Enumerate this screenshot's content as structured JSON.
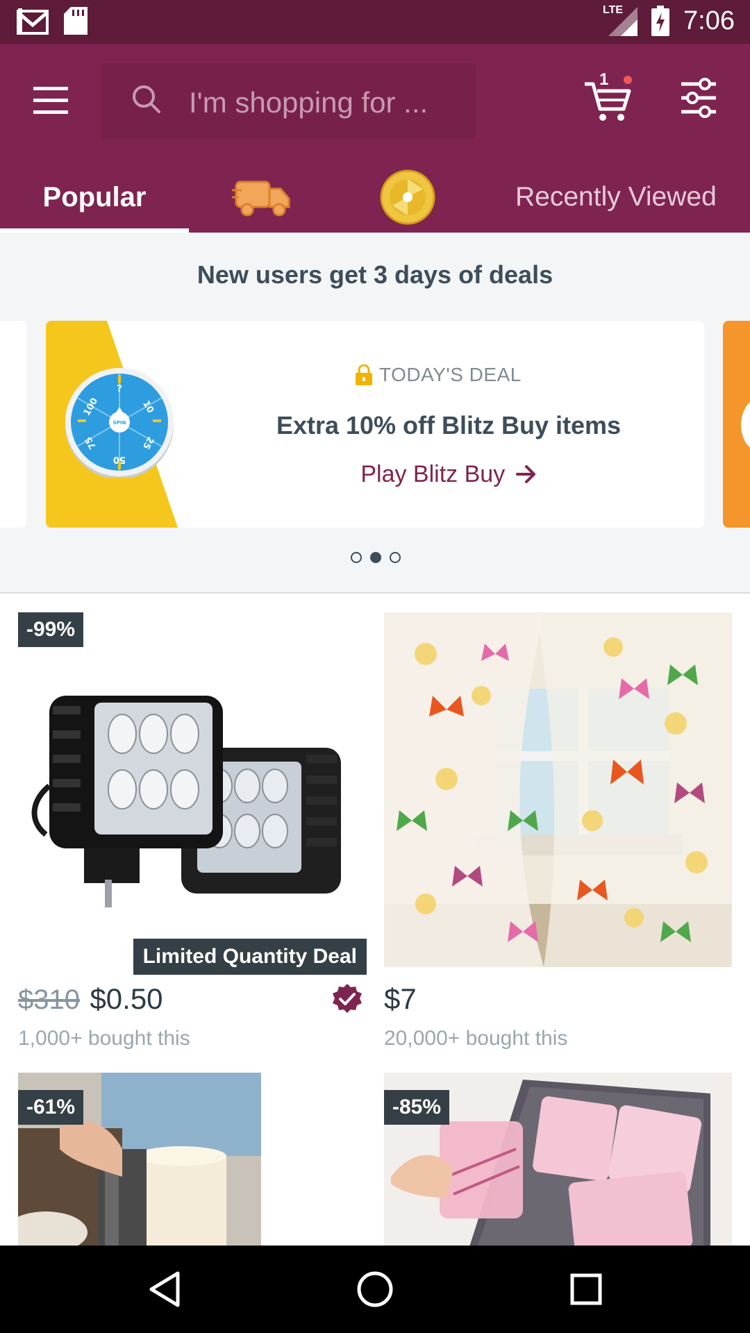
{
  "status_bar": {
    "time": "7:06",
    "network": "LTE",
    "icons": [
      "gmail-icon",
      "sd-card-icon",
      "signal-icon",
      "battery-charging-icon"
    ]
  },
  "header": {
    "search_placeholder": "I'm shopping for ...",
    "cart_count": "1",
    "icons": [
      "menu-icon",
      "search-icon",
      "cart-icon",
      "filter-icon"
    ]
  },
  "tabs": [
    {
      "label": "Popular",
      "active": true
    },
    {
      "icon": "shipping-truck-icon"
    },
    {
      "icon": "prize-wheel-icon"
    },
    {
      "label": "Recently Viewed"
    }
  ],
  "promo": {
    "heading": "New users get 3 days of deals",
    "deal_label": "TODAY'S DEAL",
    "deal_title": "Extra 10% off Blitz Buy items",
    "deal_cta": "Play Blitz Buy",
    "wheel_labels": [
      "?",
      "10",
      "25",
      "50",
      "75",
      "100",
      "SPIN"
    ],
    "carousel_index": 2,
    "carousel_count": 3
  },
  "products": [
    {
      "discount": "-99%",
      "badge": "Limited Quantity Deal",
      "old_price": "$310",
      "price": "$0.50",
      "bought": "1,000+ bought this",
      "verified": true,
      "image": "led-work-lights"
    },
    {
      "discount": "",
      "price": "$7",
      "bought": "20,000+ bought this",
      "image": "butterfly-curtains"
    },
    {
      "discount": "-61%",
      "image": "cake-scraper"
    },
    {
      "discount": "-85%",
      "image": "pink-packing-cubes"
    }
  ],
  "colors": {
    "status_bar": "#5e1b3a",
    "header": "#7f2450",
    "accent": "#7f2450",
    "badge": "#353f46",
    "text_dark": "#3d4d5a"
  }
}
